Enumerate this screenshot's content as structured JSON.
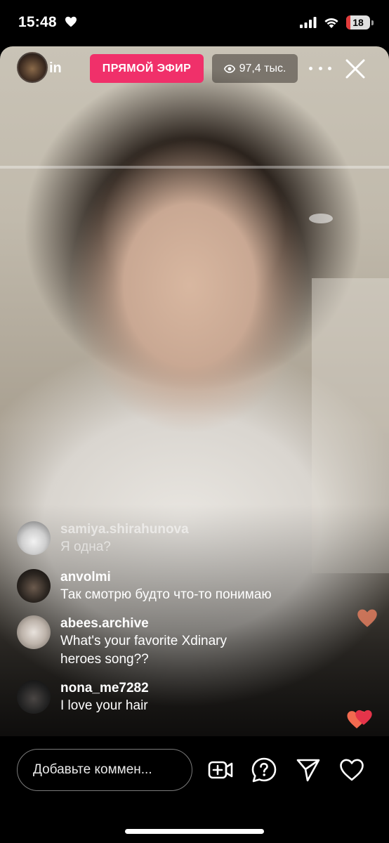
{
  "status_bar": {
    "time": "15:48",
    "battery": "18",
    "battery_level": 0.18,
    "battery_color": "#e23b3b"
  },
  "live": {
    "host_name": "in",
    "live_label": "ПРЯМОЙ ЭФИР",
    "viewers": "97,4 тыс.",
    "accent": "#f0306a"
  },
  "comments": [
    {
      "user": "samiya.shirahunova",
      "text": "Я одна?",
      "faded": true
    },
    {
      "user": "anvolmi",
      "text": "Так смотрю будто что-то понимаю",
      "faded": false
    },
    {
      "user": "abees.archive",
      "text_lines": [
        "What's your favorite Xdinary",
        "heroes song??"
      ],
      "faded": false
    },
    {
      "user": "nona_me7282",
      "text": "I love your hair",
      "faded": false
    }
  ],
  "bottom": {
    "comment_placeholder": "Добавьте коммен...",
    "icons": [
      "add-guest-icon",
      "question-icon",
      "send-icon",
      "heart-icon"
    ]
  }
}
